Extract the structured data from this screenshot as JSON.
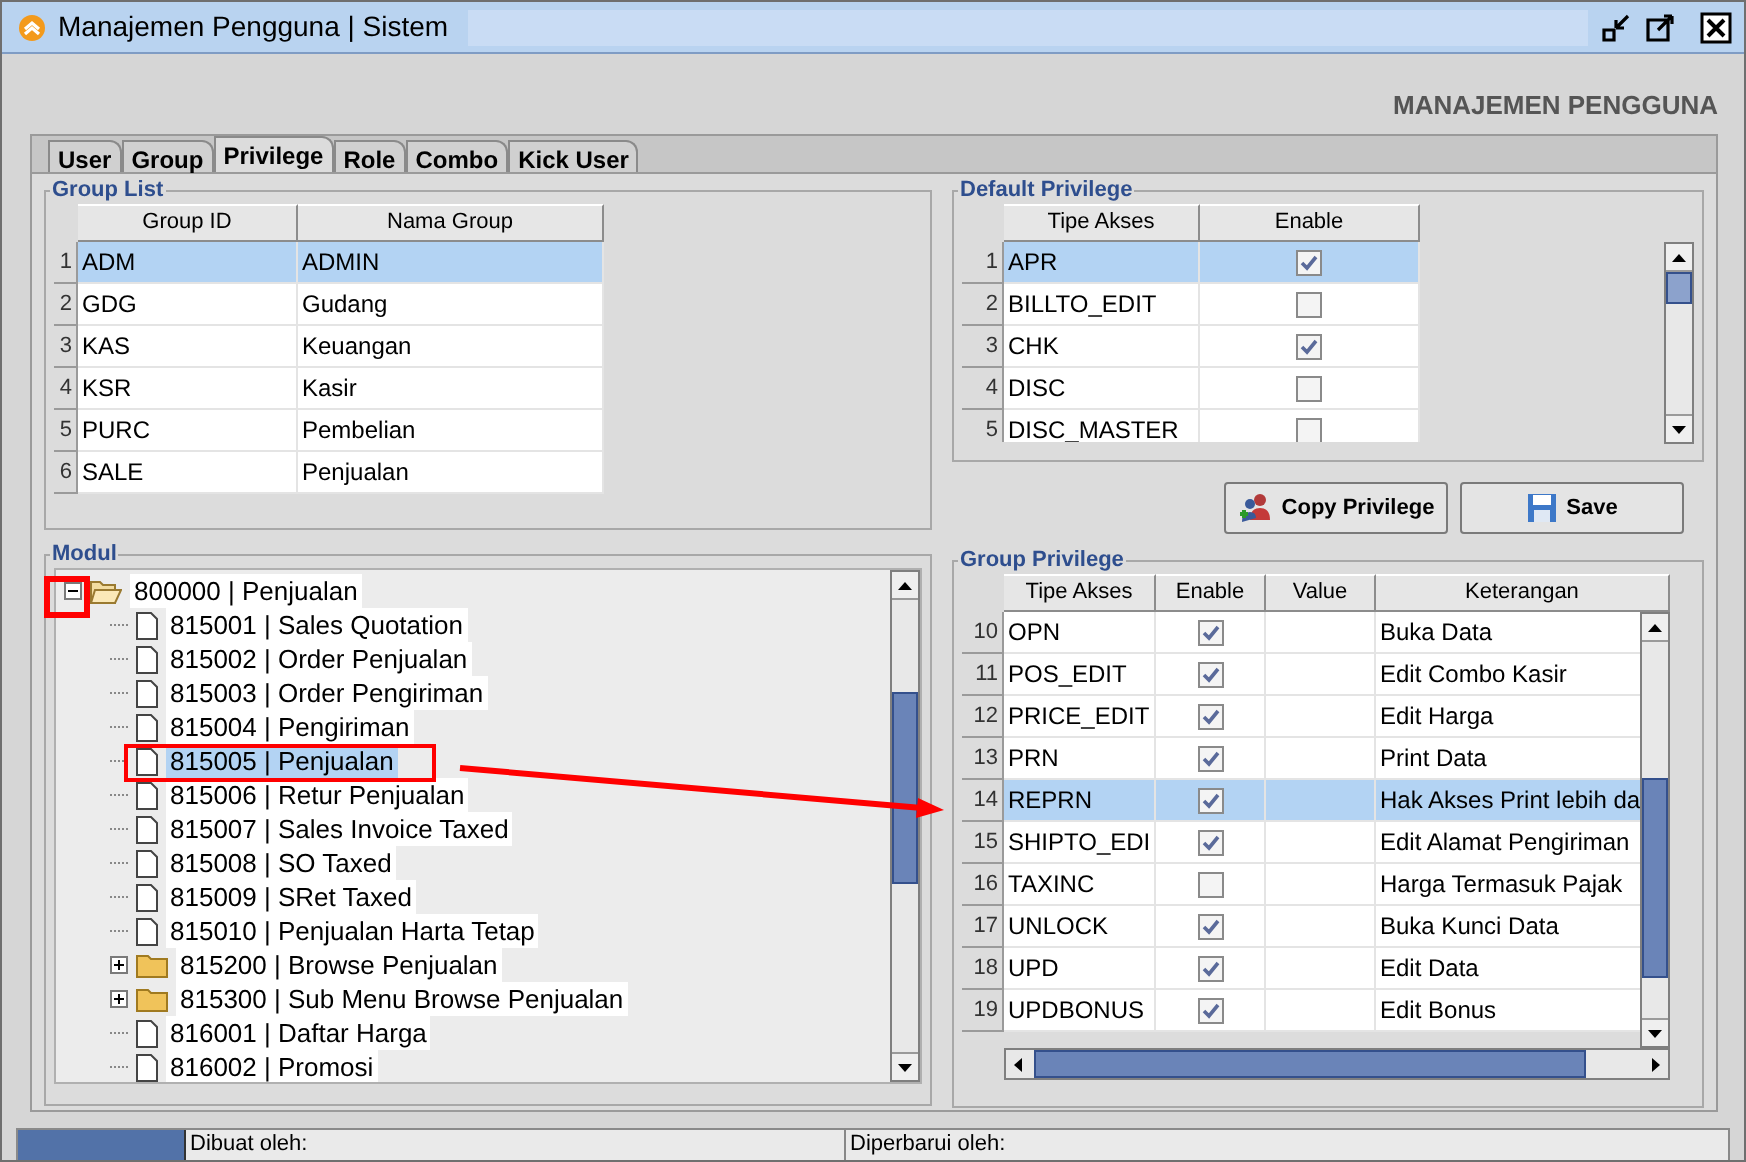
{
  "window": {
    "title": "Manajemen Pengguna | Sistem"
  },
  "header": "MANAJEMEN PENGGUNA",
  "tabs": [
    {
      "label": "User",
      "selected": false
    },
    {
      "label": "Group",
      "selected": false
    },
    {
      "label": "Privilege",
      "selected": true
    },
    {
      "label": "Role",
      "selected": false
    },
    {
      "label": "Combo",
      "selected": false
    },
    {
      "label": "Kick User",
      "selected": false
    }
  ],
  "group_list": {
    "title": "Group List",
    "columns": [
      "Group ID",
      "Nama Group"
    ],
    "rows": [
      {
        "no": "1",
        "id": "ADM",
        "name": "ADMIN",
        "selected": true
      },
      {
        "no": "2",
        "id": "GDG",
        "name": "Gudang",
        "selected": false
      },
      {
        "no": "3",
        "id": "KAS",
        "name": "Keuangan",
        "selected": false
      },
      {
        "no": "4",
        "id": "KSR",
        "name": "Kasir",
        "selected": false
      },
      {
        "no": "5",
        "id": "PURC",
        "name": "Pembelian",
        "selected": false
      },
      {
        "no": "6",
        "id": "SALE",
        "name": "Penjualan",
        "selected": false
      }
    ]
  },
  "modul": {
    "title": "Modul",
    "tree": [
      {
        "label": "800000 | Penjualan",
        "kind": "folder",
        "expanded": true,
        "selected": false,
        "children": [
          {
            "label": "815001 | Sales Quotation",
            "kind": "page",
            "selected": false
          },
          {
            "label": "815002 | Order Penjualan",
            "kind": "page",
            "selected": false
          },
          {
            "label": "815003 | Order Pengiriman",
            "kind": "page",
            "selected": false
          },
          {
            "label": "815004 | Pengiriman",
            "kind": "page",
            "selected": false
          },
          {
            "label": "815005 | Penjualan",
            "kind": "page",
            "selected": true
          },
          {
            "label": "815006 | Retur Penjualan",
            "kind": "page",
            "selected": false
          },
          {
            "label": "815007 | Sales Invoice Taxed",
            "kind": "page",
            "selected": false
          },
          {
            "label": "815008 | SO Taxed",
            "kind": "page",
            "selected": false
          },
          {
            "label": "815009 | SRet Taxed",
            "kind": "page",
            "selected": false
          },
          {
            "label": "815010 | Penjualan Harta Tetap",
            "kind": "page",
            "selected": false
          },
          {
            "label": "815200 | Browse Penjualan",
            "kind": "folder",
            "expanded": false,
            "selected": false
          },
          {
            "label": "815300 | Sub Menu Browse Penjualan",
            "kind": "folder",
            "expanded": false,
            "selected": false
          },
          {
            "label": "816001 | Daftar Harga",
            "kind": "page",
            "selected": false
          },
          {
            "label": "816002 | Promosi",
            "kind": "page",
            "selected": false
          }
        ]
      }
    ]
  },
  "default_privilege": {
    "title": "Default Privilege",
    "columns": [
      "Tipe Akses",
      "Enable"
    ],
    "rows": [
      {
        "no": "1",
        "tipe": "APR",
        "enable": true,
        "selected": true
      },
      {
        "no": "2",
        "tipe": "BILLTO_EDIT",
        "enable": false,
        "selected": false
      },
      {
        "no": "3",
        "tipe": "CHK",
        "enable": true,
        "selected": false
      },
      {
        "no": "4",
        "tipe": "DISC",
        "enable": false,
        "selected": false
      },
      {
        "no": "5",
        "tipe": "DISC_MASTER",
        "enable": false,
        "selected": false
      }
    ]
  },
  "buttons": [
    {
      "label": "Copy Privilege",
      "kind": "copy"
    },
    {
      "label": "Save",
      "kind": "save"
    }
  ],
  "group_privilege": {
    "title": "Group Privilege",
    "columns": [
      "Tipe Akses",
      "Enable",
      "Value",
      "Keterangan"
    ],
    "rows": [
      {
        "no": "10",
        "tipe": "OPN",
        "enable": true,
        "keterangan": "Buka Data",
        "selected": false
      },
      {
        "no": "11",
        "tipe": "POS_EDIT",
        "enable": true,
        "keterangan": "Edit Combo Kasir",
        "selected": false
      },
      {
        "no": "12",
        "tipe": "PRICE_EDIT",
        "enable": true,
        "keterangan": "Edit Harga",
        "selected": false
      },
      {
        "no": "13",
        "tipe": "PRN",
        "enable": true,
        "keterangan": "Print Data",
        "selected": false
      },
      {
        "no": "14",
        "tipe": "REPRN",
        "enable": true,
        "keterangan": "Hak Akses Print lebih da",
        "selected": true
      },
      {
        "no": "15",
        "tipe": "SHIPTO_EDI",
        "enable": true,
        "keterangan": "Edit Alamat Pengiriman",
        "selected": false
      },
      {
        "no": "16",
        "tipe": "TAXINC",
        "enable": false,
        "keterangan": "Harga Termasuk Pajak",
        "selected": false
      },
      {
        "no": "17",
        "tipe": "UNLOCK",
        "enable": true,
        "keterangan": "Buka Kunci Data",
        "selected": false
      },
      {
        "no": "18",
        "tipe": "UPD",
        "enable": true,
        "keterangan": "Edit Data",
        "selected": false
      },
      {
        "no": "19",
        "tipe": "UPDBONUS",
        "enable": true,
        "keterangan": "Edit Bonus",
        "selected": false
      }
    ]
  },
  "status_bar": {
    "created": "Dibuat oleh:",
    "updated": "Diperbarui oleh:"
  }
}
